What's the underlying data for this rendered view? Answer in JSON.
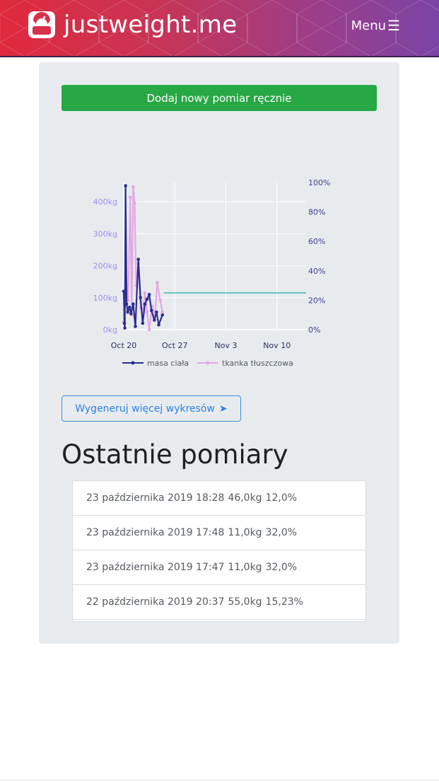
{
  "header": {
    "brand_name": "justweight.me",
    "logo_icon": "scale-icon",
    "menu_label": "Menu",
    "menu_icon": "hamburger-icon"
  },
  "main": {
    "add_button_label": "Dodaj nowy pomiar ręcznie",
    "more_charts_button_label": "Wygeneruj więcej wykresów",
    "more_charts_arrow": "➤",
    "recent_title": "Ostatnie pomiary"
  },
  "measurements": [
    {
      "date": "23 października 2019 18:28",
      "weight": "46,0kg",
      "fat": "12,0%"
    },
    {
      "date": "23 października 2019 17:48",
      "weight": "11,0kg",
      "fat": "32,0%"
    },
    {
      "date": "23 października 2019 17:47",
      "weight": "11,0kg",
      "fat": "32,0%"
    },
    {
      "date": "22 października 2019 20:37",
      "weight": "55,0kg",
      "fat": "15,23%"
    }
  ],
  "chart_data": {
    "type": "line",
    "x_ticks": [
      "Oct 20",
      "Oct 27",
      "Nov 3",
      "Nov 10"
    ],
    "y_left_ticks": [
      "0kg",
      "100kg",
      "200kg",
      "300kg",
      "400kg"
    ],
    "y_left_range": [
      0,
      460
    ],
    "y_right_ticks": [
      "0%",
      "20%",
      "40%",
      "60%",
      "80%",
      "100%"
    ],
    "y_right_range": [
      0,
      100
    ],
    "x_range_days": [
      0,
      25
    ],
    "grid": true,
    "legend_position": "bottom",
    "colors": {
      "weight": "#2b2d8f",
      "fat": "#e2a9e2",
      "reference": "#3fb8b0"
    },
    "reference_line": {
      "y": 25,
      "x_start": 5.5,
      "x_end": 25
    },
    "series": [
      {
        "name": "masa ciała",
        "color": "#2b2d8f",
        "points": [
          [
            0.0,
            120
          ],
          [
            0.1,
            20
          ],
          [
            0.15,
            5
          ],
          [
            0.25,
            450
          ],
          [
            0.4,
            80
          ],
          [
            0.55,
            55
          ],
          [
            0.8,
            70
          ],
          [
            1.0,
            50
          ],
          [
            1.3,
            80
          ],
          [
            1.6,
            10
          ],
          [
            2.0,
            220
          ],
          [
            2.3,
            100
          ],
          [
            2.6,
            20
          ],
          [
            2.9,
            80
          ],
          [
            3.2,
            95
          ],
          [
            3.5,
            110
          ],
          [
            3.8,
            60
          ],
          [
            4.2,
            30
          ],
          [
            4.5,
            55
          ],
          [
            4.8,
            15
          ],
          [
            5.3,
            46
          ]
        ]
      },
      {
        "name": "tkanka tłuszczowa",
        "color": "#e2a9e2",
        "points": [
          [
            0.0,
            5
          ],
          [
            0.3,
            35
          ],
          [
            0.6,
            20
          ],
          [
            0.9,
            90
          ],
          [
            1.1,
            10
          ],
          [
            1.3,
            97
          ],
          [
            1.5,
            86
          ],
          [
            1.7,
            30
          ],
          [
            2.0,
            45
          ],
          [
            2.3,
            15
          ],
          [
            2.6,
            12
          ],
          [
            2.9,
            25
          ],
          [
            3.2,
            12
          ],
          [
            3.5,
            0
          ],
          [
            3.9,
            16
          ],
          [
            4.3,
            10
          ],
          [
            4.6,
            32
          ],
          [
            5.0,
            20
          ],
          [
            5.3,
            12
          ]
        ]
      }
    ]
  }
}
